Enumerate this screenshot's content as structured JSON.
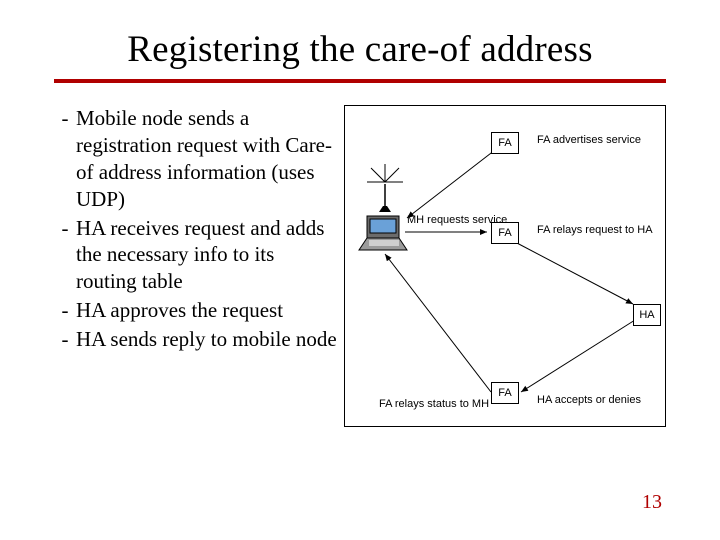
{
  "title": "Registering the care-of address",
  "bullets": [
    "Mobile node sends a registration request with Care-of address information (uses UDP)",
    "HA receives request and adds the necessary info to its routing table",
    "HA approves the request",
    "HA sends reply to mobile node"
  ],
  "diagram": {
    "fa_label": "FA",
    "ha_label": "HA",
    "mh_label": "MH requests service",
    "advert_label": "FA advertises service",
    "relay_req_label": "FA relays request to HA",
    "relay_status_label": "FA relays status to MH",
    "accept_label": "HA accepts or denies"
  },
  "page_number": "13"
}
